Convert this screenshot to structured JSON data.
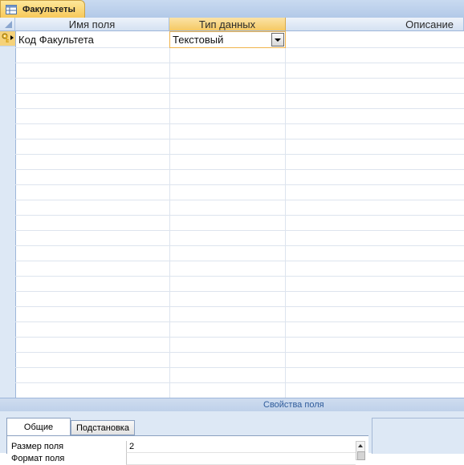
{
  "document_tab": {
    "title": "Факультеты",
    "icon": "table-icon"
  },
  "grid": {
    "columns": [
      {
        "label": "Имя поля"
      },
      {
        "label": "Тип данных"
      },
      {
        "label": "Описание"
      }
    ],
    "rows": [
      {
        "field_name": "Код Факультета",
        "data_type": "Текстовый",
        "description": "",
        "is_primary_key": true
      }
    ]
  },
  "field_properties": {
    "title": "Свойства поля",
    "tabs": [
      {
        "label": "Общие",
        "active": true
      },
      {
        "label": "Подстановка",
        "active": false
      }
    ],
    "properties": [
      {
        "name": "Размер поля",
        "value": "2"
      },
      {
        "name": "Формат поля",
        "value": ""
      }
    ]
  },
  "colors": {
    "active_tab": "#f8c95a",
    "selected_column": "#f5c964",
    "panel_blue": "#dde8f5",
    "accent_text": "#2f5c9b"
  }
}
